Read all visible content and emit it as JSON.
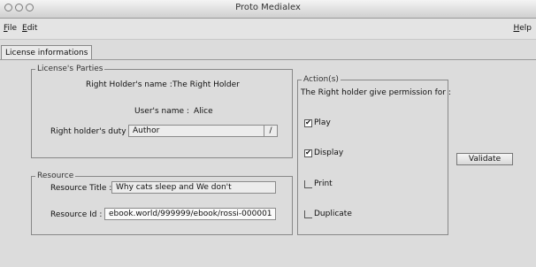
{
  "window": {
    "title": "Proto Medialex"
  },
  "menubar": {
    "file": "File",
    "edit": "Edit",
    "help": "Help"
  },
  "tabs": [
    {
      "label": "License informations",
      "active": true
    }
  ],
  "parties": {
    "legend": "License's Parties",
    "holder_label": "Right Holder's name :",
    "holder_value": "The Right Holder",
    "user_label": "User's name :",
    "user_value": "Alice",
    "duty_label": "Right holder's duty",
    "duty_value": "Author"
  },
  "resource": {
    "legend": "Resource",
    "title_label": "Resource Title :",
    "title_value": "Why cats sleep and We don't",
    "id_label": "Resource Id :",
    "id_value": "ebook.world/999999/ebook/rossi-000001"
  },
  "actions": {
    "legend": "Action(s)",
    "intro": "The Right holder give permission for :",
    "items": [
      {
        "label": "Play",
        "checked": true
      },
      {
        "label": "Display",
        "checked": true
      },
      {
        "label": "Print",
        "checked": false
      },
      {
        "label": "Duplicate",
        "checked": false
      }
    ]
  },
  "validate_label": "Validate",
  "icons": {
    "check": "✔",
    "combo": "/"
  }
}
